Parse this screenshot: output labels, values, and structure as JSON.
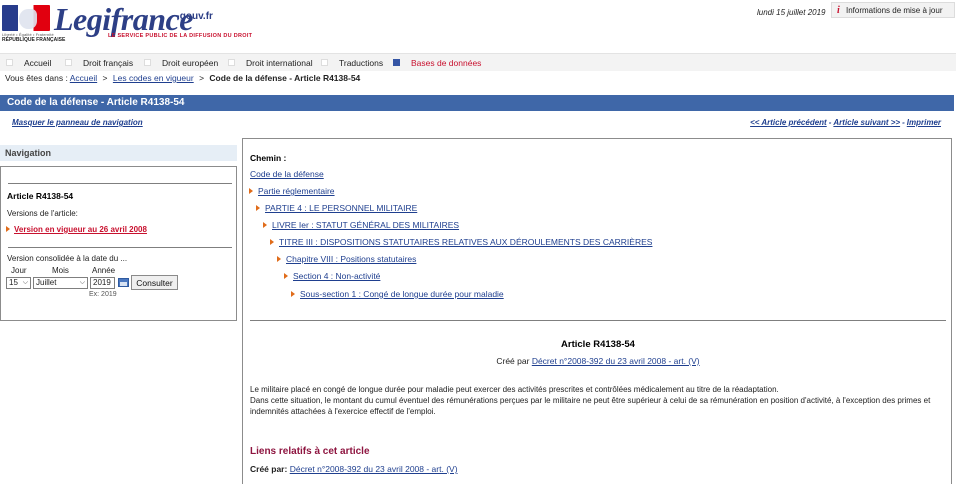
{
  "header": {
    "motto": "Liberté • Égalité • Fraternité",
    "republic": "RÉPUBLIQUE FRANÇAISE",
    "logo": "Legifrance",
    "logo_suffix": ".gouv.fr",
    "tagline": "LE SERVICE PUBLIC DE LA DIFFUSION DU DROIT",
    "date": "lundi 15 juillet 2019",
    "info_icon": "i",
    "info_label": "Informations de mise à jour"
  },
  "topnav": [
    {
      "label": "Accueil",
      "active": false
    },
    {
      "label": "Droit français",
      "active": false
    },
    {
      "label": "Droit européen",
      "active": false
    },
    {
      "label": "Droit international",
      "active": false
    },
    {
      "label": "Traductions",
      "active": false
    },
    {
      "label": "Bases de données",
      "active": true
    }
  ],
  "breadcrumb": {
    "prefix": "Vous êtes dans :",
    "items": [
      "Accueil",
      "Les codes en vigueur"
    ],
    "separator": ">",
    "current": "Code de la défense - Article R4138-54"
  },
  "title_bar": "Code de la défense - Article R4138-54",
  "actions": {
    "hide_panel": "Masquer le panneau de navigation",
    "previous": "<< Article précédent",
    "next": "Article suivant >>",
    "print": "Imprimer",
    "separator": "-"
  },
  "navigation": {
    "header": "Navigation",
    "article": "Article R4138-54",
    "versions_label": "Versions de l'article:",
    "current_version": "Version en vigueur au 26 avril 2008",
    "consolidated_label": "Version consolidée à la date du ...",
    "day_label": "Jour",
    "month_label": "Mois",
    "year_label": "Année",
    "day_value": "15",
    "month_value": "Juillet",
    "year_value": "2019",
    "consult_button": "Consulter",
    "year_hint": "Ex: 2019",
    "dropdown_glyph": "⌵"
  },
  "content": {
    "chemin_label": "Chemin :",
    "code_link": "Code de la défense",
    "path": [
      "Partie réglementaire",
      "PARTIE 4 : LE PERSONNEL MILITAIRE",
      "LIVRE Ier : STATUT GÉNÉRAL DES MILITAIRES",
      "TITRE III : DISPOSITIONS STATUTAIRES RELATIVES AUX DÉROULEMENTS DES CARRIÈRES",
      "Chapitre VIII : Positions statutaires",
      "Section 4 : Non-activité",
      "Sous-section 1 : Congé de longue durée pour maladie"
    ],
    "article_title": "Article R4138-54",
    "created_by_label": "Créé par",
    "decree_link": "Décret n°2008-392 du 23 avril 2008 - art. (V)",
    "paragraphs": [
      "Le militaire placé en congé de longue durée pour maladie peut exercer des activités prescrites et contrôlées médicalement au titre de la réadaptation.",
      "Dans cette situation, le montant du cumul éventuel des rémunérations perçues par le militaire ne peut être supérieur à celui de sa rémunération en position d'activité, à l'exception des primes et indemnités attachées à l'exercice effectif de l'emploi."
    ],
    "related_title": "Liens relatifs à cet article",
    "related_created_label": "Créé par:",
    "related_decree_link": "Décret n°2008-392 du 23 avril 2008 - art. (V)"
  },
  "colors": {
    "brand_blue": "#3f67a8",
    "link": "#1f3f8f",
    "accent_red": "#c8102e",
    "arrow_orange": "#e06c1a",
    "related_title": "#8e1540"
  }
}
